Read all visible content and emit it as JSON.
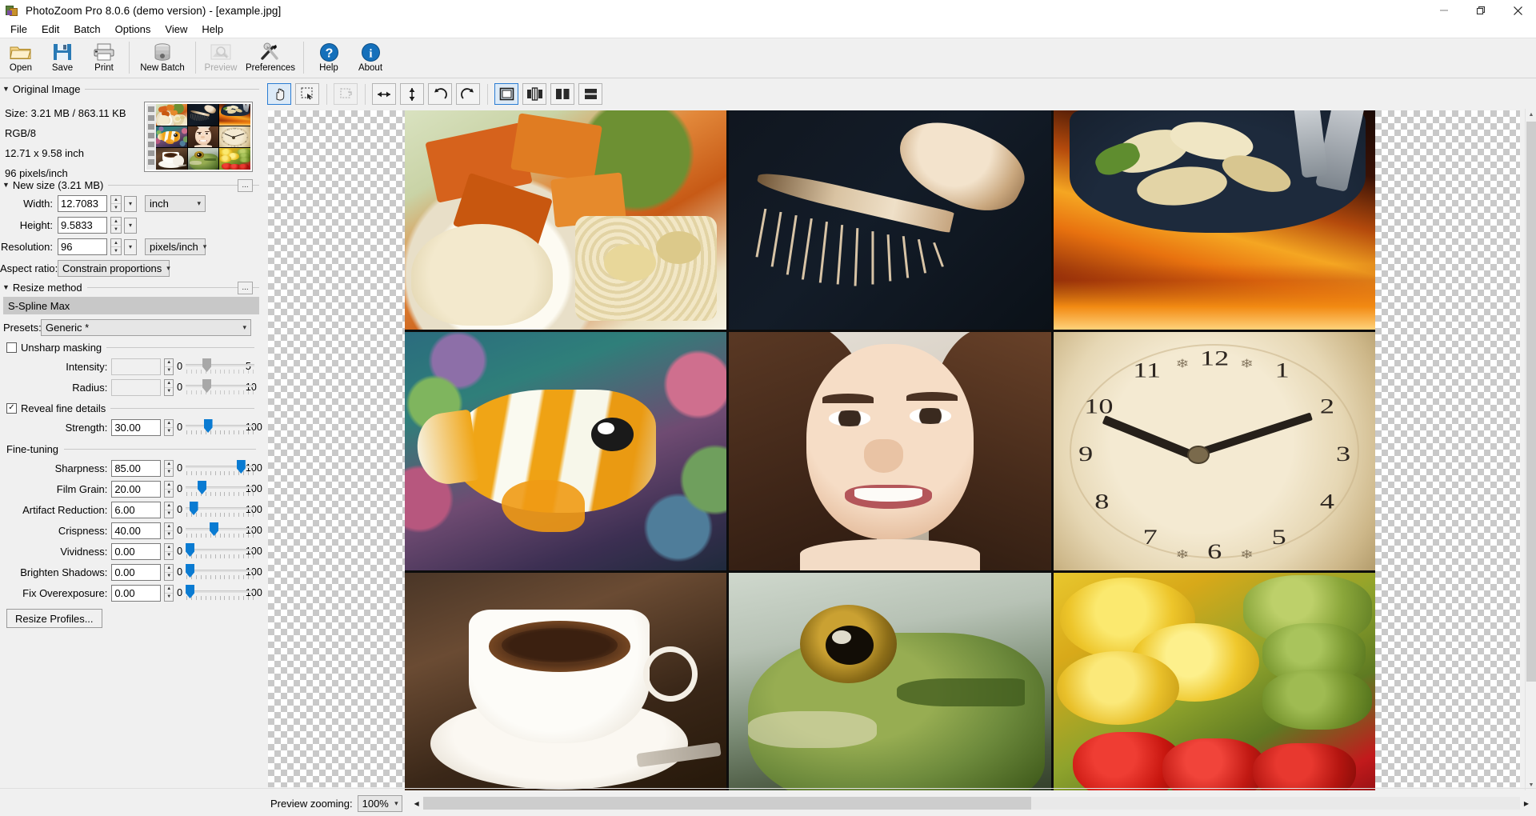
{
  "window": {
    "title": "PhotoZoom Pro 8.0.6 (demo version) - [example.jpg]",
    "app_icon": "photozoom-logo-icon",
    "minimize": "minimize-icon",
    "maximize": "restore-icon",
    "close": "close-icon"
  },
  "menubar": {
    "items": [
      "File",
      "Edit",
      "Batch",
      "Options",
      "View",
      "Help"
    ]
  },
  "toolbar": {
    "buttons": [
      {
        "label": "Open",
        "icon": "folder-open-icon",
        "enabled": true
      },
      {
        "label": "Save",
        "icon": "floppy-save-icon",
        "enabled": true
      },
      {
        "label": "Print",
        "icon": "printer-icon",
        "enabled": true
      },
      {
        "label": "New Batch",
        "icon": "database-batch-icon",
        "enabled": true
      },
      {
        "label": "Preview",
        "icon": "image-magnify-icon",
        "enabled": false
      },
      {
        "label": "Preferences",
        "icon": "wrench-screwdriver-icon",
        "enabled": true
      },
      {
        "label": "Help",
        "icon": "question-circle-icon",
        "enabled": true
      },
      {
        "label": "About",
        "icon": "info-circle-icon",
        "enabled": true
      }
    ]
  },
  "original_image": {
    "group_title": "Original Image",
    "size": "Size: 3.21 MB / 863.11 KB",
    "color_mode": "RGB/8",
    "dimensions": "12.71 x 9.58 inch",
    "resolution": "96 pixels/inch",
    "thumbnail_name": "original-image-thumbnail"
  },
  "new_size": {
    "group_title": "New size (3.21 MB)",
    "width_label": "Width:",
    "width_value": "12.7083",
    "height_label": "Height:",
    "height_value": "9.5833",
    "unit_value": "inch",
    "resolution_label": "Resolution:",
    "resolution_value": "96",
    "resolution_unit": "pixels/inch",
    "aspect_label": "Aspect ratio:",
    "aspect_value": "Constrain proportions",
    "more_button": "..."
  },
  "resize_method": {
    "group_title": "Resize method",
    "method": "S-Spline Max",
    "presets_label": "Presets:",
    "presets_value": "Generic *",
    "more_button": "...",
    "unsharp": {
      "label": "Unsharp masking",
      "checked": false,
      "rows": [
        {
          "label": "Intensity:",
          "value": "",
          "min": "0",
          "max": "5",
          "pct": 28,
          "enabled": false
        },
        {
          "label": "Radius:",
          "value": "",
          "min": "0",
          "max": "10",
          "pct": 28,
          "enabled": false
        }
      ]
    },
    "reveal": {
      "label": "Reveal fine details",
      "checked": true,
      "rows": [
        {
          "label": "Strength:",
          "value": "30.00",
          "min": "0",
          "max": "100",
          "pct": 30,
          "enabled": true
        }
      ]
    },
    "fine_tuning": {
      "label": "Fine-tuning",
      "rows": [
        {
          "label": "Sharpness:",
          "value": "85.00",
          "min": "0",
          "max": "100",
          "pct": 85,
          "enabled": true
        },
        {
          "label": "Film Grain:",
          "value": "20.00",
          "min": "0",
          "max": "100",
          "pct": 20,
          "enabled": true
        },
        {
          "label": "Artifact Reduction:",
          "value": "6.00",
          "min": "0",
          "max": "100",
          "pct": 6,
          "enabled": true
        },
        {
          "label": "Crispness:",
          "value": "40.00",
          "min": "0",
          "max": "100",
          "pct": 40,
          "enabled": true
        },
        {
          "label": "Vividness:",
          "value": "0.00",
          "min": "0",
          "max": "100",
          "pct": 0,
          "enabled": true
        },
        {
          "label": "Brighten Shadows:",
          "value": "0.00",
          "min": "0",
          "max": "100",
          "pct": 0,
          "enabled": true
        },
        {
          "label": "Fix Overexposure:",
          "value": "0.00",
          "min": "0",
          "max": "100",
          "pct": 0,
          "enabled": true
        }
      ]
    },
    "profiles_button": "Resize Profiles..."
  },
  "preview_toolbar": {
    "buttons": [
      {
        "name": "pan-hand-tool",
        "icon": "hand-icon",
        "selected": true,
        "enabled": true
      },
      {
        "name": "marquee-select-tool",
        "icon": "marquee-select-icon",
        "selected": false,
        "enabled": true
      },
      {
        "name": "crop-tool",
        "icon": "crop-icon",
        "selected": false,
        "enabled": false
      },
      {
        "name": "flip-horizontal",
        "icon": "arrows-horizontal-icon",
        "selected": false,
        "enabled": true
      },
      {
        "name": "flip-vertical",
        "icon": "arrows-vertical-icon",
        "selected": false,
        "enabled": true
      },
      {
        "name": "rotate-left",
        "icon": "rotate-ccw-icon",
        "selected": false,
        "enabled": true
      },
      {
        "name": "rotate-right",
        "icon": "rotate-cw-icon",
        "selected": false,
        "enabled": true
      },
      {
        "name": "view-single",
        "icon": "single-pane-icon",
        "selected": true,
        "enabled": true
      },
      {
        "name": "view-split",
        "icon": "split-pane-icon",
        "selected": false,
        "enabled": true
      },
      {
        "name": "view-side-by-side",
        "icon": "two-pane-icon",
        "selected": false,
        "enabled": true
      },
      {
        "name": "view-stacked",
        "icon": "stacked-pane-icon",
        "selected": false,
        "enabled": true
      }
    ]
  },
  "preview": {
    "cells": [
      {
        "name": "roasted-vegetables-photo",
        "alt": "Roasted carrots and couscous bowl"
      },
      {
        "name": "seashell-photo",
        "alt": "Spiny murex seashell on dark fabric"
      },
      {
        "name": "grilled-food-photo",
        "alt": "Pan of grilled potatoes over flames"
      },
      {
        "name": "tropical-fish-photo",
        "alt": "Copperband butterflyfish in reef"
      },
      {
        "name": "smiling-woman-portrait-photo",
        "alt": "Smiling woman portrait"
      },
      {
        "name": "antique-clock-photo",
        "alt": "Antique clock face close-up"
      },
      {
        "name": "coffee-cup-photo",
        "alt": "Espresso cup on saucer"
      },
      {
        "name": "frog-photo",
        "alt": "Green frog close-up"
      },
      {
        "name": "fruit-vegetables-photo",
        "alt": "Sliced yellow tomatoes, sprouts, strawberries"
      }
    ]
  },
  "status": {
    "zoom_label": "Preview zooming:",
    "zoom_value": "100%",
    "scroll_left": "left-arrow-icon",
    "scroll_right": "right-arrow-icon"
  },
  "colors": {
    "accent": "#0a7bd2",
    "selected_border": "#2b7cd3",
    "panel_bg": "#f0f0f0",
    "method_bar": "#c8c8c8"
  }
}
